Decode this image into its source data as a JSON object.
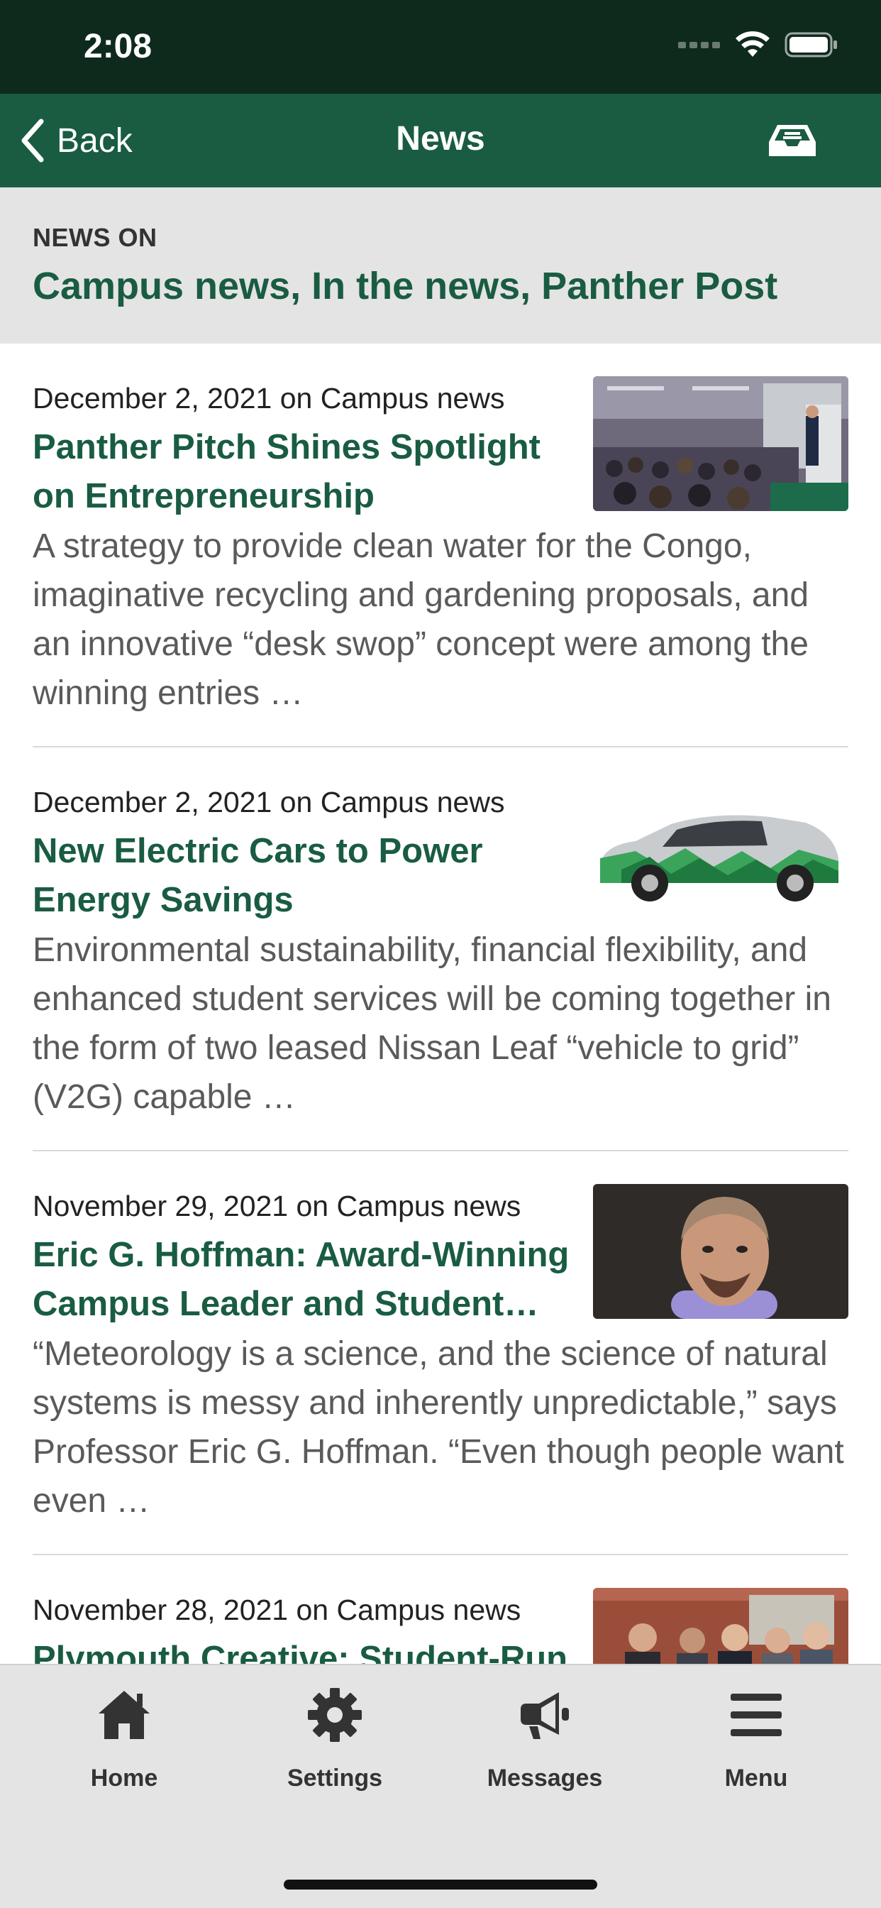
{
  "status_bar": {
    "time": "2:08"
  },
  "nav": {
    "back_label": "Back",
    "title": "News"
  },
  "header": {
    "label": "NEWS ON",
    "categories": "Campus news, In the news, Panther Post"
  },
  "articles": [
    {
      "meta": "December 2, 2021 on Campus news",
      "title": "Panther Pitch Shines Spotlight on Entrepreneurship",
      "excerpt": "A strategy to provide clean water for the Congo, imaginative recycling and gardening proposals, and an innovative “desk swop” concept were among the winning entries …",
      "image": "conference-presentation-photo"
    },
    {
      "meta": "December 2, 2021 on Campus news",
      "title": "New Electric Cars to Power Energy Savings",
      "excerpt": "Environmental sustainability, financial flexibility, and enhanced student services will be coming together in the form of two leased Nissan Leaf “vehicle to grid” (V2G) capable …",
      "image": "electric-car-photo"
    },
    {
      "meta": "November 29, 2021 on Campus news",
      "title": "Eric G. Hoffman: Award-Winning Campus Leader and Student…",
      "excerpt": "“Meteorology is a science, and the science of natural systems is messy and inherently unpredictable,” says Professor Eric G. Hoffman. “Even though people want even …",
      "image": "portrait-photo"
    },
    {
      "meta": "November 28, 2021 on Campus news",
      "title": "Plymouth Creative: Student-Run",
      "excerpt": "",
      "image": "group-photo"
    }
  ],
  "tabs": [
    {
      "label": "Home",
      "icon": "home-icon"
    },
    {
      "label": "Settings",
      "icon": "gear-icon"
    },
    {
      "label": "Messages",
      "icon": "megaphone-icon"
    },
    {
      "label": "Menu",
      "icon": "hamburger-icon"
    }
  ],
  "colors": {
    "status_bar": "#0e2a1d",
    "nav_bar": "#195c42",
    "accent_green": "#195c42",
    "header_bg": "#e4e4e4",
    "tab_bar_bg": "#e4e4e4"
  }
}
